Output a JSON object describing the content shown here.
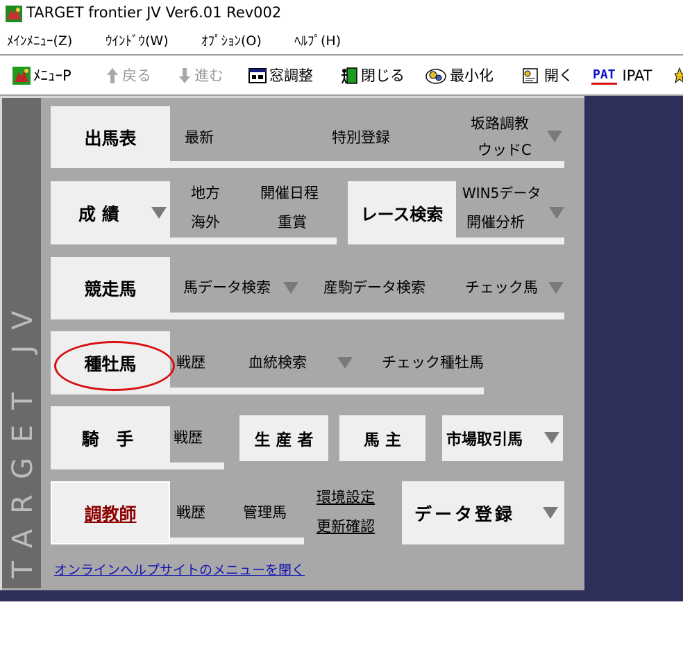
{
  "window": {
    "title": "TARGET frontier JV  Ver6.01  Rev002"
  },
  "menubar": [
    "ﾒｲﾝﾒﾆｭｰ(Z)",
    "ｳｲﾝﾄﾞｳ(W)",
    "ｵﾌﾟｼｮﾝ(O)",
    "ﾍﾙﾌﾟ(H)"
  ],
  "toolbar": {
    "menu_p": "ﾒﾆｭｰP",
    "back": "戻る",
    "forward": "進む",
    "window_adjust": "窓調整",
    "close": "閉じる",
    "minimize": "最小化",
    "open": "開く",
    "ipat_badge": "PAT",
    "ipat": "IPAT"
  },
  "sidebar": {
    "text": "TARGET JV"
  },
  "rows": {
    "shutsuba": {
      "main": "出馬表",
      "latest": "最新",
      "special": "特別登録",
      "hanro": "坂路調教",
      "wood": "ウッドC"
    },
    "seiseki": {
      "main": "成 績",
      "chiho": "地方",
      "kaigai": "海外",
      "schedule": "開催日程",
      "jusho": "重賞",
      "race_search": "レース検索",
      "win5": "WIN5データ",
      "analysis": "開催分析"
    },
    "horse": {
      "main": "競走馬",
      "data_search": "馬データ検索",
      "foal_search": "産駒データ検索",
      "check": "チェック馬"
    },
    "stallion": {
      "main": "種牡馬",
      "record": "戦歴",
      "pedigree": "血統検索",
      "check": "チェック種牡馬"
    },
    "jockey": {
      "main": "騎 手",
      "record": "戦歴",
      "breeder": "生 産 者",
      "owner": "馬 主",
      "market": "市場取引馬"
    },
    "trainer": {
      "main": "調教師",
      "record": "戦歴",
      "managed": "管理馬",
      "settings": "環境設定",
      "update": "更新確認",
      "register": "データ登録"
    }
  },
  "footer": {
    "online_help": "オンラインヘルプサイトのメニューを閉く"
  },
  "colors": {
    "panel": "#a8a8a8",
    "button": "#efefef",
    "background": "#2f2f5c",
    "highlight": "#d81010",
    "trainer_text": "#8b0000"
  }
}
